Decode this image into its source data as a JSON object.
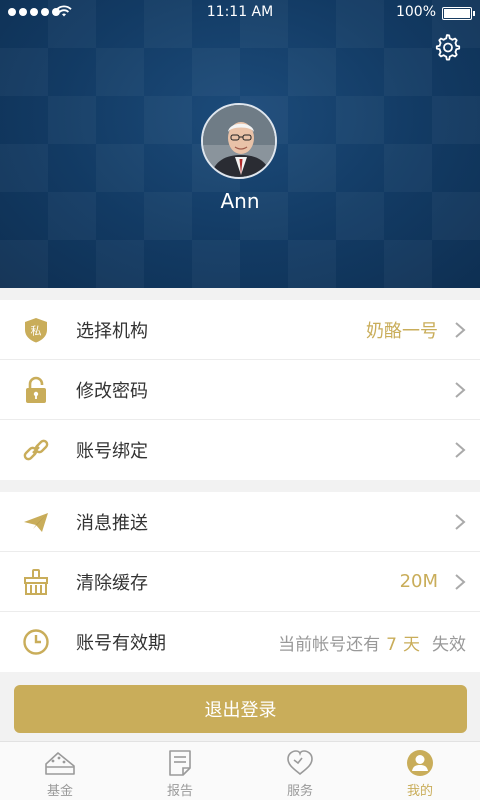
{
  "status_bar": {
    "time": "11:11 AM",
    "battery": "100%"
  },
  "profile": {
    "name": "Ann"
  },
  "group1": [
    {
      "icon": "shield-private-icon",
      "label": "选择机构",
      "value": "奶酪一号"
    },
    {
      "icon": "unlock-icon",
      "label": "修改密码",
      "value": ""
    },
    {
      "icon": "link-icon",
      "label": "账号绑定",
      "value": ""
    }
  ],
  "group2": [
    {
      "icon": "paper-plane-icon",
      "label": "消息推送",
      "value": ""
    },
    {
      "icon": "broom-icon",
      "label": "清除缓存",
      "value": "20M"
    },
    {
      "icon": "clock-icon",
      "label": "账号有效期",
      "value_prefix": "当前帐号还有",
      "value_number": "7",
      "value_unit": "天",
      "value_suffix": "失效"
    }
  ],
  "badge_text": "私",
  "logout_label": "退出登录",
  "tabs": [
    {
      "icon": "cake-icon",
      "label": "基金",
      "active": false
    },
    {
      "icon": "report-icon",
      "label": "报告",
      "active": false
    },
    {
      "icon": "heart-icon",
      "label": "服务",
      "active": false
    },
    {
      "icon": "user-icon",
      "label": "我的",
      "active": true
    }
  ],
  "colors": {
    "header": "#123a63",
    "accent": "#c9ad5a"
  }
}
